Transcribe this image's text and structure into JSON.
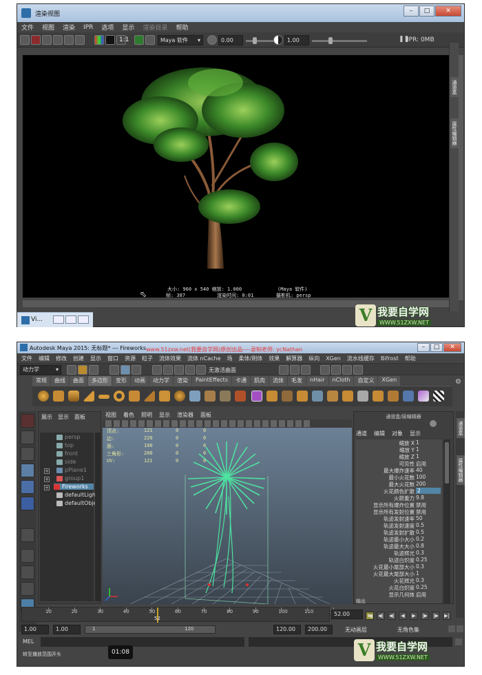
{
  "watermark": "www.51zxw.net(我要自学网)原创出品----录制老师: ycNathan",
  "logo": {
    "brand": "我要自学网",
    "url": "WWW.51ZXW.NET"
  },
  "render_view": {
    "title": "渲染视图",
    "menu": [
      "文件",
      "视图",
      "渲染",
      "IPR",
      "选项",
      "显示",
      "渲染目录",
      "帮助"
    ],
    "ratio_label": "1:1",
    "camera_select": "Maya 软件",
    "exposure": "0.00",
    "gamma": "1.00",
    "ipr_label": "IPR: 0MB",
    "info": {
      "size": "大小: 960 x 540  缩放: 1.000",
      "renderer": "(Maya 软件)",
      "frame": "帧: 387",
      "render_time": "渲染时间: 0:01",
      "camera": "摄影机: persp"
    },
    "taskbar_label": "Vi..."
  },
  "maya": {
    "title": "Autodesk Maya 2015: 无标题*   ---   Fireworks",
    "menu": [
      "文件",
      "编辑",
      "修改",
      "创建",
      "显示",
      "窗口",
      "资源",
      "粒子",
      "流体效果",
      "流体 nCache",
      "场",
      "柔体/刚体",
      "效果",
      "解算器",
      "纵向",
      "XGen",
      "流水线缓存",
      "Bifrost",
      "帮助"
    ],
    "mode_select": "动力学",
    "status_field": "无激活曲面",
    "shelf_tabs": [
      "常规",
      "曲线",
      "曲面",
      "多边形",
      "变形",
      "动画",
      "动力学",
      "渲染",
      "PaintEffects",
      "卡通",
      "肌肉",
      "流体",
      "毛发",
      "nHair",
      "nCloth",
      "自定义",
      "XGen"
    ],
    "shelf_active": "多边形",
    "outliner": {
      "menu": [
        "展示",
        "显示",
        "面板"
      ],
      "items": [
        "persp",
        "top",
        "front",
        "side",
        "pPlane1",
        "group1",
        "Fireworks",
        "defaultLigh",
        "defaultObje"
      ],
      "selected": "Fireworks"
    },
    "viewport_menu": [
      "视图",
      "着色",
      "照明",
      "显示",
      "渲染器",
      "面板"
    ],
    "hud": {
      "rows": [
        {
          "label": "顶点:",
          "v1": "121",
          "v2": "0",
          "v3": "0"
        },
        {
          "label": "边:",
          "v1": "220",
          "v2": "0",
          "v3": "0"
        },
        {
          "label": "面:",
          "v1": "100",
          "v2": "0",
          "v3": "0"
        },
        {
          "label": "三角形:",
          "v1": "200",
          "v2": "0",
          "v3": "0"
        },
        {
          "label": "UV:",
          "v1": "121",
          "v2": "0",
          "v3": "0"
        }
      ]
    },
    "attribute_editor": {
      "header": "通道盒/层编辑器",
      "tabs": [
        "通道",
        "编辑",
        "对象",
        "显示"
      ],
      "rows": [
        {
          "label": "缩放 X",
          "value": "1"
        },
        {
          "label": "缩放 Y",
          "value": "1"
        },
        {
          "label": "缩放 Z",
          "value": "1"
        },
        {
          "label": "可见性",
          "value": "启用"
        },
        {
          "label": "最大爆炸速率",
          "value": "40"
        },
        {
          "label": "最小火花数",
          "value": "100"
        },
        {
          "label": "最大火花数",
          "value": "200"
        },
        {
          "label": "火花颜色扩散",
          "value": "2"
        },
        {
          "label": "火箭重力",
          "value": "9.8"
        },
        {
          "label": "显示所有爆炸位置",
          "value": "禁用"
        },
        {
          "label": "显示所有发射位置",
          "value": "禁用"
        },
        {
          "label": "轨迹发射速率",
          "value": "50"
        },
        {
          "label": "轨迹发射速度",
          "value": "0.5"
        },
        {
          "label": "轨迹发射扩散",
          "value": "0.5"
        },
        {
          "label": "轨迹最小大小",
          "value": "0.2"
        },
        {
          "label": "轨迹最大大小",
          "value": "0.8"
        },
        {
          "label": "轨迹辉光",
          "value": "0.3"
        },
        {
          "label": "轨迹白炽度",
          "value": "0.25"
        },
        {
          "label": "火花最小尾部大小",
          "value": "0.3"
        },
        {
          "label": "火花最大尾部大小",
          "value": "1"
        },
        {
          "label": "火花辉光",
          "value": "0.3"
        },
        {
          "label": "火花白炽度",
          "value": "0.25"
        },
        {
          "label": "显示几何体",
          "value": "启用"
        }
      ],
      "selected_row": "火花颜色扩散",
      "footer": "输出"
    },
    "timeline": {
      "ticks": [
        "10",
        "20",
        "30",
        "40",
        "50",
        "60",
        "70",
        "80",
        "90",
        "100",
        "110",
        "120"
      ],
      "current_frame_label": "52",
      "current_frame_field": "52.00"
    },
    "range": {
      "start": "1.00",
      "playback_start": "1.00",
      "range_start_inner": "1",
      "range_end_inner": "120",
      "playback_end": "120.00",
      "end": "200.00",
      "anim_layer": "无动画层",
      "char_set": "无角色集"
    },
    "mel_label": "MEL",
    "help_text": "转至播放范围开头",
    "time_bubble": "01:08"
  }
}
